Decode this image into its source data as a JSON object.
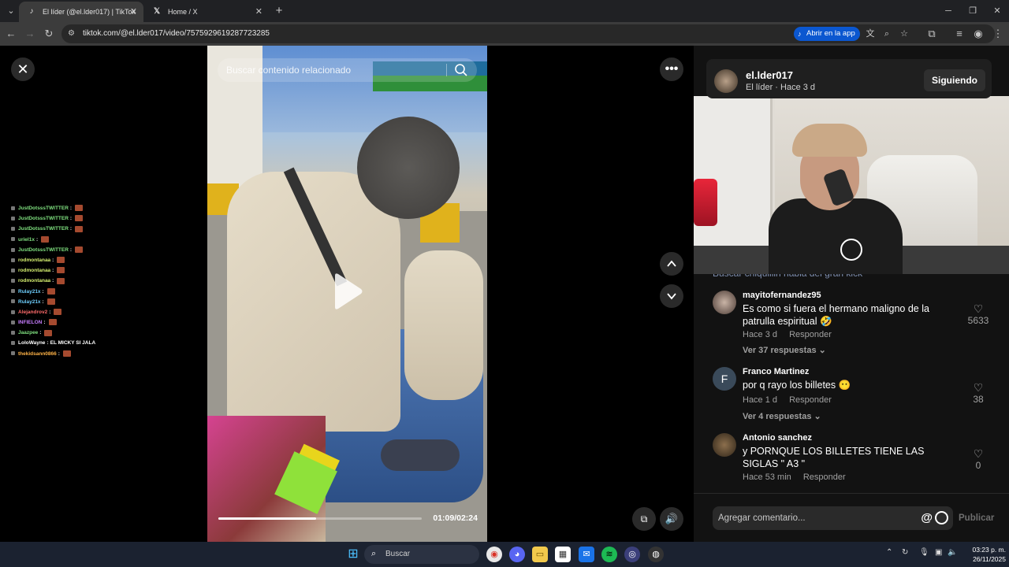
{
  "browser": {
    "tabs": [
      {
        "title": "El líder (@el.lder017) | TikTok",
        "active": true
      },
      {
        "title": "Home / X",
        "active": false
      }
    ],
    "url": "tiktok.com/@el.lder017/video/7575929619287723285",
    "open_in_app": "Abrir en la app"
  },
  "video": {
    "search_placeholder": "Buscar contenido relacionado",
    "time": "01:09/02:24",
    "progress": 0.48
  },
  "chat": [
    {
      "user": "JustDotsssTWITTER",
      "color": "#7fe07f",
      "sep": ":",
      "text": ""
    },
    {
      "user": "JustDotsssTWITTER",
      "color": "#7fe07f",
      "sep": ":",
      "text": ""
    },
    {
      "user": "JustDotsssTWITTER",
      "color": "#7fe07f",
      "sep": ":",
      "text": ""
    },
    {
      "user": "uriel1x",
      "color": "#7fe07f",
      "sep": ":",
      "text": ""
    },
    {
      "user": "JustDotsssTWITTER",
      "color": "#7fe07f",
      "sep": ":",
      "text": ""
    },
    {
      "user": "rodmontanaa",
      "color": "#d6f070",
      "sep": ":",
      "text": ""
    },
    {
      "user": "rodmontanaa",
      "color": "#d6f070",
      "sep": ":",
      "text": ""
    },
    {
      "user": "rodmontanaa",
      "color": "#d6f070",
      "sep": ":",
      "text": ""
    },
    {
      "user": "Rulay21x",
      "color": "#6fd0ff",
      "sep": ":",
      "text": ""
    },
    {
      "user": "Rulay21x",
      "color": "#6fd0ff",
      "sep": ":",
      "text": ""
    },
    {
      "user": "Alejandrov2",
      "color": "#ff6b6b",
      "sep": ":",
      "text": ""
    },
    {
      "user": "INFIELON",
      "color": "#c77dff",
      "sep": ":",
      "text": ""
    },
    {
      "user": "Jaazpee",
      "color": "#7fe07f",
      "sep": ":",
      "text": ""
    },
    {
      "user": "LoloWayne",
      "color": "#ffffff",
      "sep": ":",
      "text": "EL MICKY SI JALA"
    },
    {
      "user": "thekidsann0866",
      "color": "#ffb347",
      "sep": ":",
      "text": ""
    }
  ],
  "author": {
    "name": "el.lder017",
    "subtitle": "El líder · Hace 3 d",
    "follow_label": "Siguiendo"
  },
  "cut_comment_text": "Buscar chiquillin habla del gran kick",
  "comments": [
    {
      "name": "mayitofernandez95",
      "text": "Es como si fuera el hermano maligno de la patrulla espiritual 🤣",
      "time": "Hace 3 d",
      "reply": "Responder",
      "replies": "Ver 37 respuestas",
      "likes": "5633"
    },
    {
      "name": "Franco Martinez",
      "text": "por q rayo los billetes 😶",
      "time": "Hace 1 d",
      "reply": "Responder",
      "replies": "Ver 4 respuestas",
      "likes": "38",
      "initial": "F"
    },
    {
      "name": "Antonio sanchez",
      "text": "y PORNQUE LOS BILLETES TIENE LAS SIGLAS \" A3 \"",
      "time": "Hace 53 min",
      "reply": "Responder",
      "replies": "",
      "likes": "0"
    }
  ],
  "comment_input": {
    "placeholder": "Agregar comentario...",
    "publish": "Publicar"
  },
  "taskbar": {
    "search": "Buscar",
    "time": "03:23 p. m.",
    "date": "26/11/2025"
  },
  "icons": {
    "close": "close-icon",
    "more": "more-icon",
    "up": "chevron-up-icon",
    "down": "chevron-down-icon",
    "volume": "volume-icon",
    "floating": "floating-player-icon"
  }
}
